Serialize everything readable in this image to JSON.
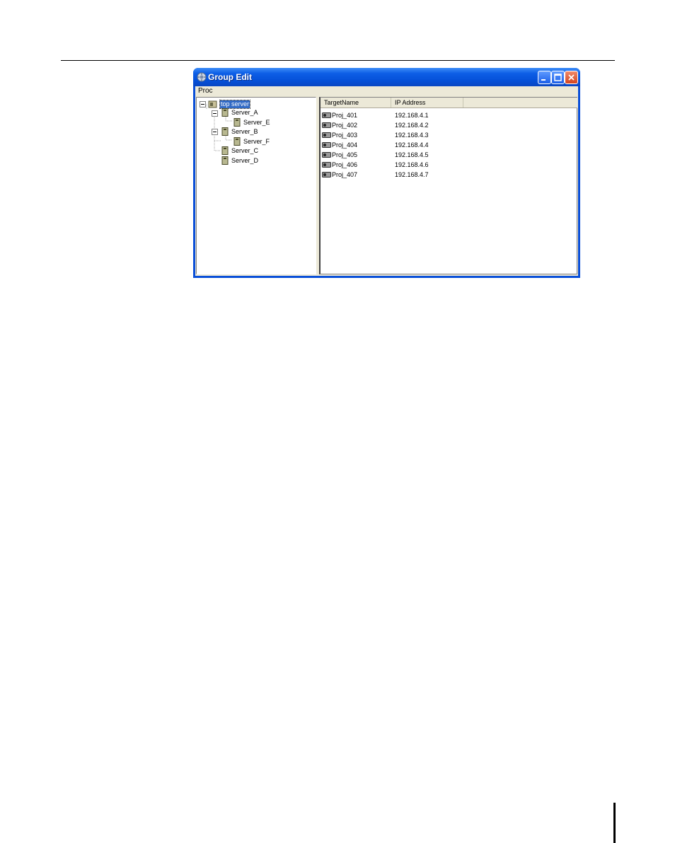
{
  "window": {
    "title": "Group Edit",
    "menu": {
      "proc": "Proc"
    }
  },
  "tree": {
    "root": "top server",
    "nodes": [
      {
        "label": "Server_A"
      },
      {
        "label": "Server_E"
      },
      {
        "label": "Server_B"
      },
      {
        "label": "Server_F"
      },
      {
        "label": "Server_C"
      },
      {
        "label": "Server_D"
      }
    ]
  },
  "list": {
    "columns": [
      "TargetName",
      "IP Address"
    ],
    "rows": [
      {
        "name": "Proj_401",
        "ip": "192.168.4.1"
      },
      {
        "name": "Proj_402",
        "ip": "192.168.4.2"
      },
      {
        "name": "Proj_403",
        "ip": "192.168.4.3"
      },
      {
        "name": "Proj_404",
        "ip": "192.168.4.4"
      },
      {
        "name": "Proj_405",
        "ip": "192.168.4.5"
      },
      {
        "name": "Proj_406",
        "ip": "192.168.4.6"
      },
      {
        "name": "Proj_407",
        "ip": "192.168.4.7"
      }
    ]
  },
  "colors": {
    "titlebar": "#0550d8",
    "selection": "#316ac5",
    "close": "#d2451f"
  },
  "icons": {
    "app": "gear-globe-icon",
    "server": "server-icon",
    "projector": "projector-icon"
  }
}
